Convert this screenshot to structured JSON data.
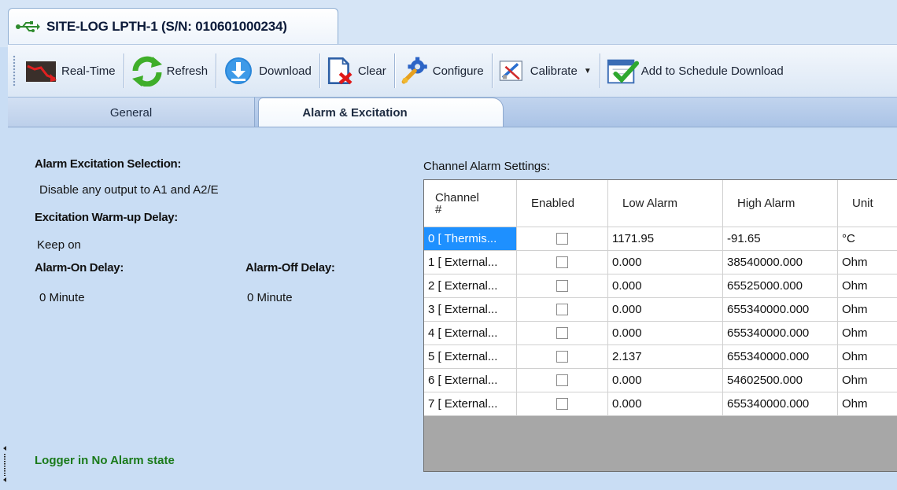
{
  "window": {
    "tab_title": "SITE-LOG LPTH-1 (S/N: 010601000234)"
  },
  "toolbar": {
    "realtime_label": "Real-Time",
    "refresh_label": "Refresh",
    "download_label": "Download",
    "clear_label": "Clear",
    "configure_label": "Configure",
    "calibrate_label": "Calibrate",
    "schedule_label": "Add to Schedule Download"
  },
  "tabs": {
    "general": "General",
    "alarm": "Alarm & Excitation"
  },
  "left_panel": {
    "excitation_selection_label": "Alarm  Excitation Selection:",
    "excitation_selection_value": "Disable any output to A1 and A2/E",
    "warmup_label": "Excitation Warm-up Delay:",
    "warmup_value": "Keep on",
    "alarm_on_label": "Alarm-On Delay:",
    "alarm_on_value": "0 Minute",
    "alarm_off_label": "Alarm-Off Delay:",
    "alarm_off_value": "0 Minute",
    "status": "Logger in No Alarm state"
  },
  "channel_table": {
    "label": "Channel Alarm Settings:",
    "headers": [
      "Channel #",
      "Enabled",
      "Low Alarm",
      "High Alarm",
      "Unit"
    ],
    "rows": [
      {
        "channel": "0 [ Thermis...",
        "enabled": false,
        "low": "1171.95",
        "high": "-91.65",
        "unit": "°C"
      },
      {
        "channel": "1 [ External...",
        "enabled": false,
        "low": "0.000",
        "high": "38540000.000",
        "unit": "Ohm"
      },
      {
        "channel": "2 [ External...",
        "enabled": false,
        "low": "0.000",
        "high": "65525000.000",
        "unit": "Ohm"
      },
      {
        "channel": "3 [ External...",
        "enabled": false,
        "low": "0.000",
        "high": "655340000.000",
        "unit": "Ohm"
      },
      {
        "channel": "4 [ External...",
        "enabled": false,
        "low": "0.000",
        "high": "655340000.000",
        "unit": "Ohm"
      },
      {
        "channel": "5 [ External...",
        "enabled": false,
        "low": "2.137",
        "high": "655340000.000",
        "unit": "Ohm"
      },
      {
        "channel": "6 [ External...",
        "enabled": false,
        "low": "0.000",
        "high": "54602500.000",
        "unit": "Ohm"
      },
      {
        "channel": "7 [ External...",
        "enabled": false,
        "low": "0.000",
        "high": "655340000.000",
        "unit": "Ohm"
      }
    ]
  },
  "icons": [
    "usb-icon",
    "realtime-chart-icon",
    "refresh-icon",
    "download-icon",
    "clear-icon",
    "configure-icon",
    "calibrate-icon",
    "schedule-download-icon"
  ]
}
